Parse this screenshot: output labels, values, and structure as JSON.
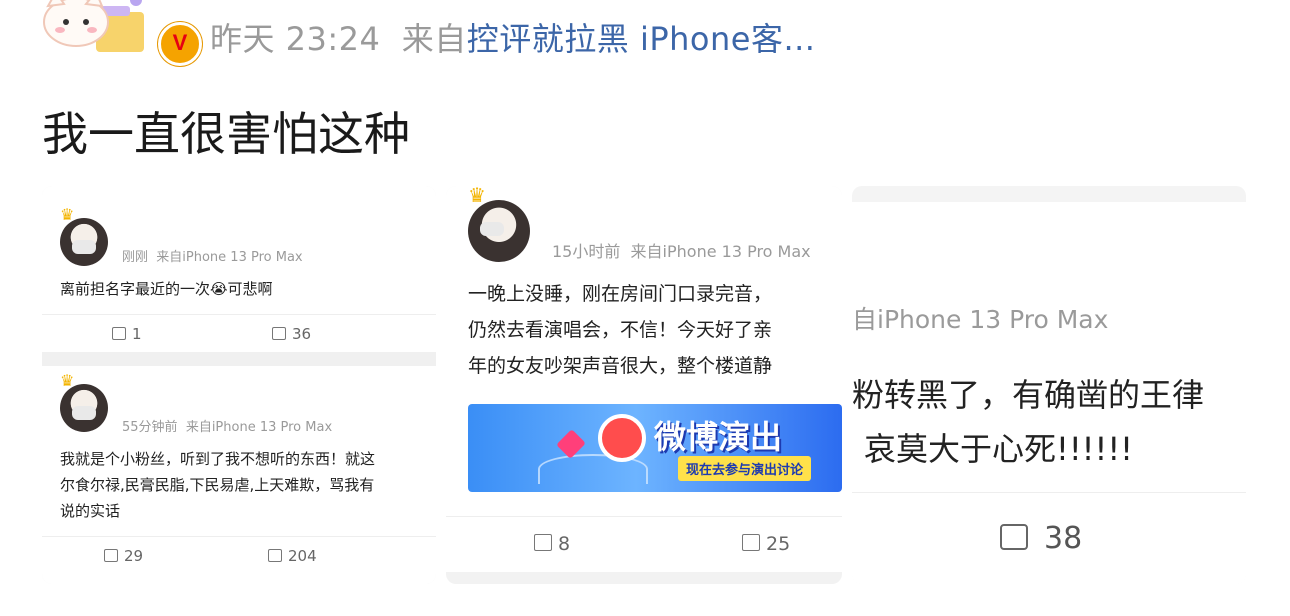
{
  "post": {
    "time": "昨天 23:24",
    "source_prefix": "来自",
    "source": "控评就拉黑 iPhone客...",
    "text": "我一直很害怕这种"
  },
  "shot1": {
    "card1": {
      "time": "刚刚",
      "source": "来自iPhone 13 Pro Max",
      "text": "离前担名字最近的一次😭可悲啊",
      "reposts": "1",
      "comments": "36"
    },
    "card2": {
      "time": "55分钟前",
      "source": "来自iPhone 13 Pro Max",
      "lines": [
        "我就是个小粉丝，听到了我不想听的东西！就这",
        "尔食尔禄,民膏民脂,下民易虐,上天难欺，骂我有",
        "说的实话"
      ],
      "reposts": "29",
      "comments": "204"
    }
  },
  "shot2": {
    "time": "15小时前",
    "source": "来自iPhone 13 Pro Max",
    "lines": [
      "一晚上没睡，刚在房间门口录完音，",
      "仍然去看演唱会，不信！今天好了亲",
      "年的女友吵架声音很大，整个楼道静"
    ],
    "banner_title": "微博演出",
    "banner_sub": "现在去参与演出讨论",
    "reposts": "8",
    "comments": "25"
  },
  "shot3": {
    "source": "自iPhone 13 Pro Max",
    "lines": [
      "粉转黑了，有确凿的王律",
      "哀莫大于心死!!!!!!"
    ],
    "comments": "38"
  }
}
